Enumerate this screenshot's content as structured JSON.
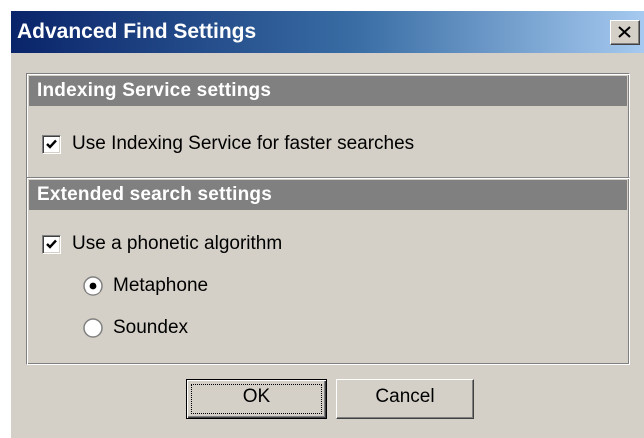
{
  "window": {
    "title": "Advanced Find Settings",
    "close_icon": "close-icon"
  },
  "indexing": {
    "header": "Indexing Service settings",
    "use_indexing_label": "Use Indexing Service for faster searches",
    "use_indexing_checked": true
  },
  "extended": {
    "header": "Extended search settings",
    "phonetic_label": "Use a phonetic algorithm",
    "phonetic_checked": true,
    "algorithms": [
      {
        "label": "Metaphone",
        "selected": true
      },
      {
        "label": "Soundex",
        "selected": false
      }
    ]
  },
  "buttons": {
    "ok_label": "OK",
    "cancel_label": "Cancel"
  },
  "colors": {
    "title_gradient_start": "#0a246a",
    "title_gradient_end": "#a6caf0",
    "dialog_face": "#d4d0c8",
    "group_header_bg": "#808080"
  }
}
